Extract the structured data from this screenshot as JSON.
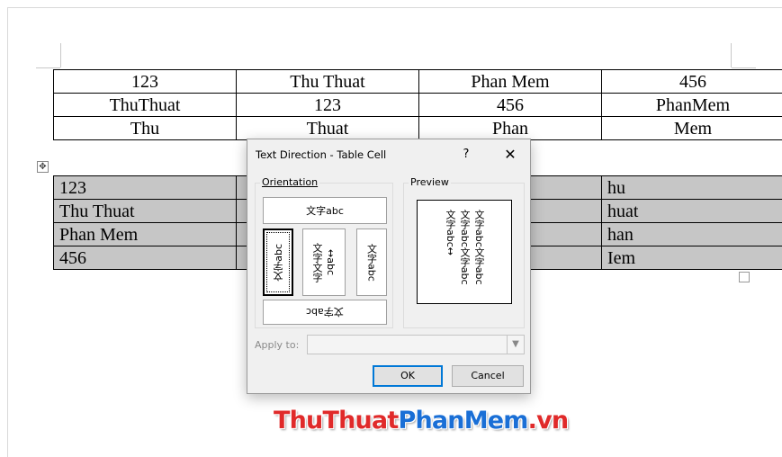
{
  "table_top": {
    "rows": [
      [
        "123",
        "Thu Thuat",
        "Phan Mem",
        "456"
      ],
      [
        "ThuThuat",
        "123",
        "456",
        "PhanMem"
      ],
      [
        "Thu",
        "Thuat",
        "Phan",
        "Mem"
      ]
    ]
  },
  "table_selected": {
    "col1": [
      "123",
      "Thu Thuat",
      "Phan Mem",
      "456"
    ],
    "col4": [
      "hu",
      "huat",
      "han",
      "Iem"
    ]
  },
  "dialog": {
    "title": "Text Direction - Table Cell",
    "help": "?",
    "close": "✕",
    "orientation_label": "Orientation",
    "preview_label": "Preview",
    "orientation_options": {
      "horizontal": "文字abc",
      "vertical_up": "文字abc",
      "stacked_a": "文字文字",
      "stacked_b": "↔abc",
      "vertical_down": "文字abc",
      "horizontal_flipped": "文字abc"
    },
    "preview_lines": [
      "文字abc文字abc",
      "文字abc文字abc",
      "文字abc↔"
    ],
    "apply_to_label": "Apply to:",
    "apply_to_value": "",
    "ok": "OK",
    "cancel": "Cancel"
  },
  "watermark": {
    "part1": "ThuThuat",
    "part2": "PhanMem",
    "part3": ".vn"
  },
  "icons": {
    "move_handle": "move-icon",
    "dropdown": "chevron-down-icon"
  }
}
